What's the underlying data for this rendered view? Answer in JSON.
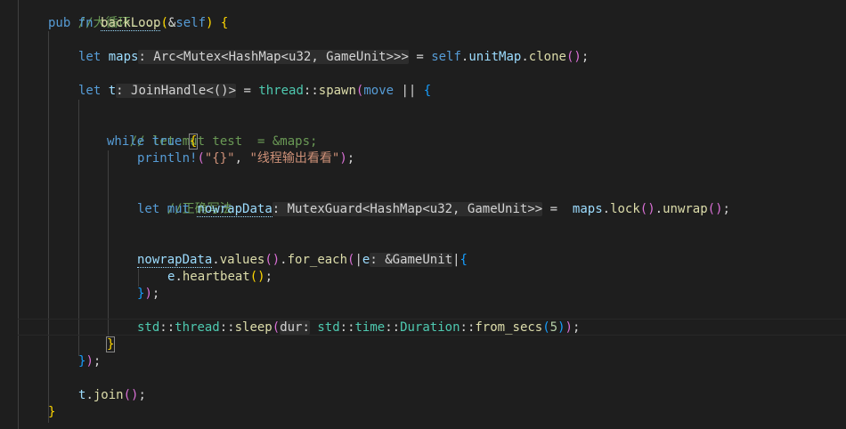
{
  "code": {
    "l01": {
      "comment": "//大循环......"
    },
    "l02": {
      "kw_pub": "pub",
      "kw_fn": "fn",
      "fn_name": "backLoop",
      "p_open": "(",
      "p_amp": "&",
      "kw_self": "self",
      "p_close": ")",
      "b_open": " {"
    },
    "l03": {
      "kw_let": "let",
      "var": "maps",
      "hint": ": Arc<Mutex<HashMap<u32, GameUnit>>>",
      "eq": " = ",
      "self": "self",
      "dot1": ".",
      "field": "unitMap",
      "dot2": ".",
      "method": "clone",
      "call": "()",
      "semi": ";"
    },
    "l04": {
      "kw_let": "let",
      "var": "t",
      "hint": ": JoinHandle<()>",
      "eq": " = ",
      "mod": "thread",
      "sep": "::",
      "fn": "spawn",
      "p_open": "(",
      "kw_move": "move",
      "bars": " || ",
      "b_open": "{"
    },
    "l05": {
      "comment": "// let mut test  = &maps;"
    },
    "l06": {
      "kw_while": "while",
      "kw_true": "true",
      "b_open": "{"
    },
    "l07": {
      "macro": "println!",
      "p_open": "(",
      "str1": "\"{}\"",
      "comma": ", ",
      "str2": "\"线程输出看看\"",
      "p_close": ")",
      "semi": ";"
    },
    "l08": {
      "comment": "//正确写法"
    },
    "l09": {
      "kw_let": "let",
      "kw_mut": "mut",
      "var": "nowrapData",
      "hint": ": MutexGuard<HashMap<u32, GameUnit>>",
      "eq": " =  ",
      "maps": "maps",
      "dot1": ".",
      "lock": "lock",
      "call1": "()",
      "dot2": ".",
      "unwrap": "unwrap",
      "call2": "()",
      "semi": ";"
    },
    "l10": {
      "var": "nowrapData",
      "dot1": ".",
      "values": "values",
      "call": "()",
      "dot2": ".",
      "for_each": "for_each",
      "p_open": "(",
      "bar1": "|",
      "param": "e",
      "hint": ": &GameUnit",
      "bar2": "|",
      "b_open": "{"
    },
    "l11": {
      "var": "e",
      "dot": ".",
      "method": "heartbeat",
      "call": "()",
      "semi": ";"
    },
    "l12": {
      "b_close": "}",
      "p_close": ")",
      "semi": ";"
    },
    "l13": {
      "mod1": "std",
      "sep1": "::",
      "mod2": "thread",
      "sep2": "::",
      "fn": "sleep",
      "p_open": "(",
      "hint": "dur:",
      "sp": " ",
      "mod3": "std",
      "sep3": "::",
      "mod4": "time",
      "sep4": "::",
      "ty": "Duration",
      "sep5": "::",
      "fn2": "from_secs",
      "p2_open": "(",
      "num": "5",
      "p2_close": ")",
      "p_close": ")",
      "semi": ";"
    },
    "l14": {
      "b_close": "}"
    },
    "l15": {
      "b_close": "}",
      "p_close": ")",
      "semi": ";"
    },
    "l16": {
      "var": "t",
      "dot": ".",
      "method": "join",
      "call": "()",
      "semi": ";"
    },
    "l17": {
      "b_close": "}"
    }
  },
  "colors": {
    "background": "#1e1e1e",
    "keyword": "#569cd6",
    "function": "#dcdcaa",
    "type": "#4ec9b0",
    "variable": "#9cdcfe",
    "string": "#ce9178",
    "comment": "#6a9955",
    "number": "#b5cea8",
    "bracket_gold": "#ffd700",
    "bracket_purple": "#da70d6",
    "bracket_blue": "#179fff"
  }
}
